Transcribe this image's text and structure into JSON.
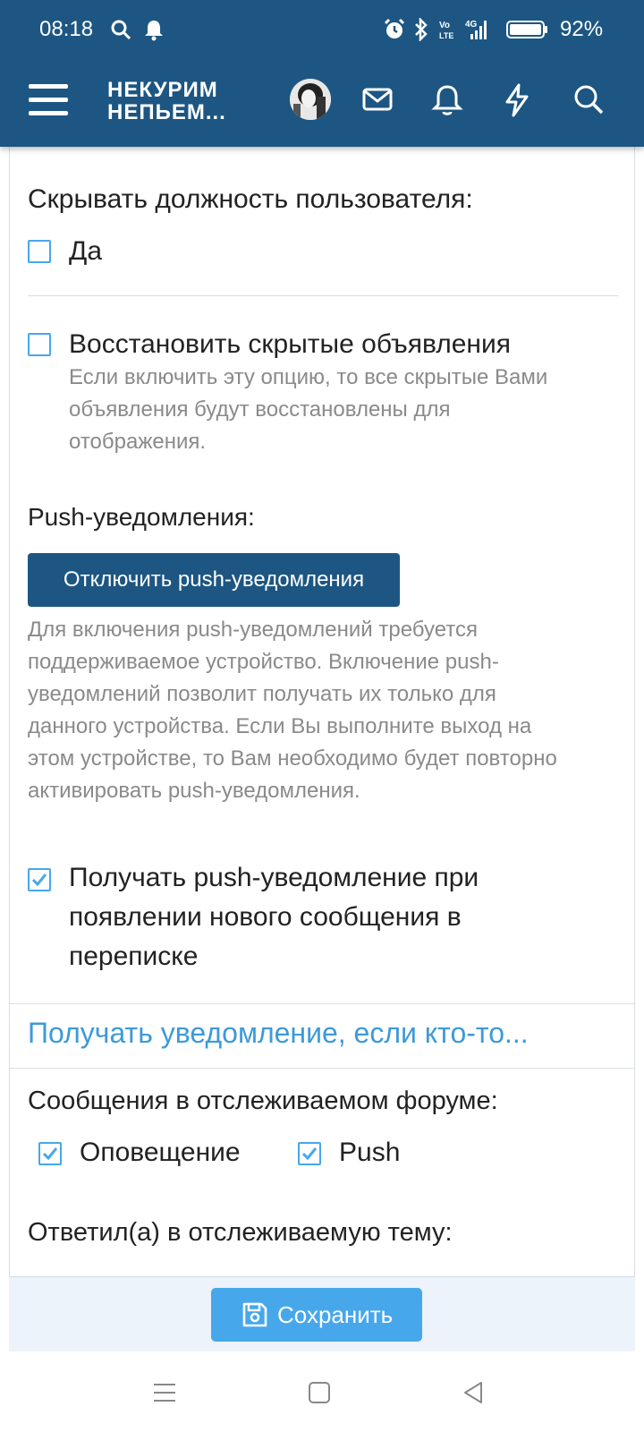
{
  "status_bar": {
    "time": "08:18",
    "battery": "92%",
    "icons": [
      "search-icon",
      "notification-bell-icon",
      "alarm-icon",
      "bluetooth-icon",
      "volte-icon",
      "signal-4g-icon",
      "battery-icon"
    ]
  },
  "header": {
    "logo_line1": "НЕКУРИМ",
    "logo_line2": "НЕПЬЕМ...",
    "icons": [
      "menu-icon",
      "avatar",
      "mail-icon",
      "bell-icon",
      "lightning-icon",
      "search-icon"
    ],
    "color": "#1d5682"
  },
  "settings": {
    "hide_title_label": "Скрывать должность пользователя:",
    "hide_title_option": "Да",
    "hide_title_checked": false,
    "restore_ads_label": "Восстановить скрытые объявления",
    "restore_ads_checked": false,
    "restore_ads_hint_1": "Если включить эту опцию, то все скрытые Вами",
    "restore_ads_hint_2": "объявления будут восстановлены для",
    "restore_ads_hint_3": "отображения.",
    "push_label": "Push-уведомления:",
    "push_button": "Отключить push-уведомления",
    "push_hint_1": "Для включения push-уведомлений требуется",
    "push_hint_2": "поддерживаемое устройство. Включение push-",
    "push_hint_3": "уведомлений позволит получать их только для",
    "push_hint_4": "данного устройства. Если Вы выполните выход на",
    "push_hint_5": "этом устройстве, то Вам необходимо будет повторно",
    "push_hint_6": "активировать push-уведомления.",
    "push_msg_line1": "Получать push-уведомление при",
    "push_msg_line2": "появлении нового сообщения в",
    "push_msg_line3": "переписке",
    "push_msg_checked": true
  },
  "notify_section": {
    "heading": "Получать уведомление, если кто-то...",
    "forum_label": "Сообщения в отслеживаемом форуме:",
    "alert_option": "Оповещение",
    "alert_checked": true,
    "push_option": "Push",
    "push_checked": true,
    "reply_label": "Ответил(а) в отслеживаемую тему:"
  },
  "save_bar": {
    "save_label": "Сохранить"
  },
  "accent_color": "#47a7eb"
}
